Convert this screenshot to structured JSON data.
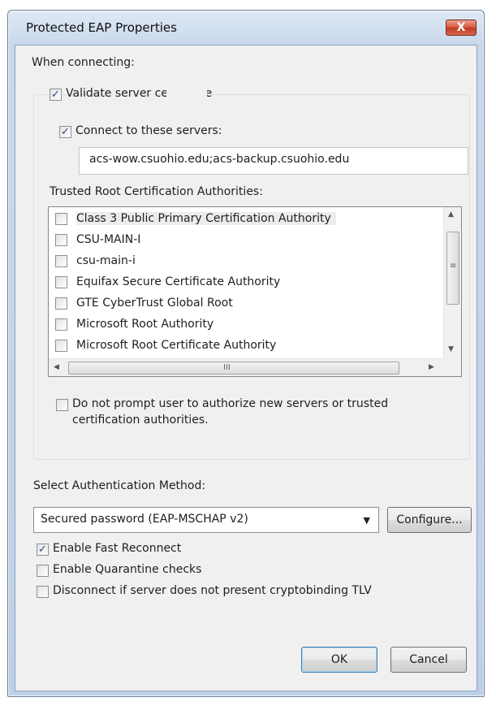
{
  "window": {
    "title": "Protected EAP Properties",
    "close_glyph": "X"
  },
  "when_connecting_label": "When connecting:",
  "validate_cert": {
    "label": "Validate server certificate",
    "checked": true
  },
  "connect_servers": {
    "label": "Connect to these servers:",
    "checked": true,
    "value": "acs-wow.csuohio.edu;acs-backup.csuohio.edu"
  },
  "trusted_root": {
    "label": "Trusted Root Certification Authorities:",
    "items": [
      {
        "label": "Class 3 Public Primary Certification Authority",
        "checked": false
      },
      {
        "label": "CSU-MAIN-I",
        "checked": false
      },
      {
        "label": "csu-main-i",
        "checked": false
      },
      {
        "label": "Equifax Secure Certificate Authority",
        "checked": false
      },
      {
        "label": "GTE CyberTrust Global Root",
        "checked": false
      },
      {
        "label": "Microsoft Root Authority",
        "checked": false
      },
      {
        "label": "Microsoft Root Certificate Authority",
        "checked": false
      }
    ],
    "scroll_up": "▲",
    "scroll_down": "▼",
    "scroll_left": "◀",
    "scroll_right": "▶",
    "vgrip": "≡",
    "hgrip": "III"
  },
  "no_prompt": {
    "label_line1": "Do not prompt user to authorize new servers or trusted",
    "label_line2": "certification authorities.",
    "checked": false
  },
  "auth_method": {
    "label": "Select Authentication Method:",
    "selected": "Secured password (EAP-MSCHAP v2)",
    "dropdown_glyph": "▼",
    "configure_label": "Configure..."
  },
  "options": [
    {
      "label": "Enable Fast Reconnect",
      "checked": true
    },
    {
      "label": "Enable Quarantine checks",
      "checked": false
    },
    {
      "label": "Disconnect if server does not present cryptobinding TLV",
      "checked": false
    }
  ],
  "buttons": {
    "ok": "OK",
    "cancel": "Cancel"
  },
  "check_glyph": "✓",
  "colors": {
    "title_bar": "#c9d9ec",
    "close_button": "#d5553c",
    "client_bg": "#f0f0f0"
  }
}
